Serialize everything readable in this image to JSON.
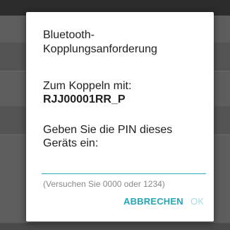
{
  "dialog": {
    "title": "Bluetooth-\nKopplungsanforderung",
    "pair_label": "Zum Koppeln mit:",
    "device_name": "RJJ00001RR_P",
    "pin_prompt": "Geben Sie die PIN dieses Geräts ein:",
    "pin_value": "",
    "hint": "(Versuchen Sie 0000 oder 1234)",
    "cancel_label": "ABBRECHEN",
    "ok_label": "OK"
  },
  "colors": {
    "accent": "#26a7b8",
    "disabled_accent": "#a8dbe2",
    "scrim": "#5d5d5d",
    "dialog_bg": "#ffffff"
  }
}
